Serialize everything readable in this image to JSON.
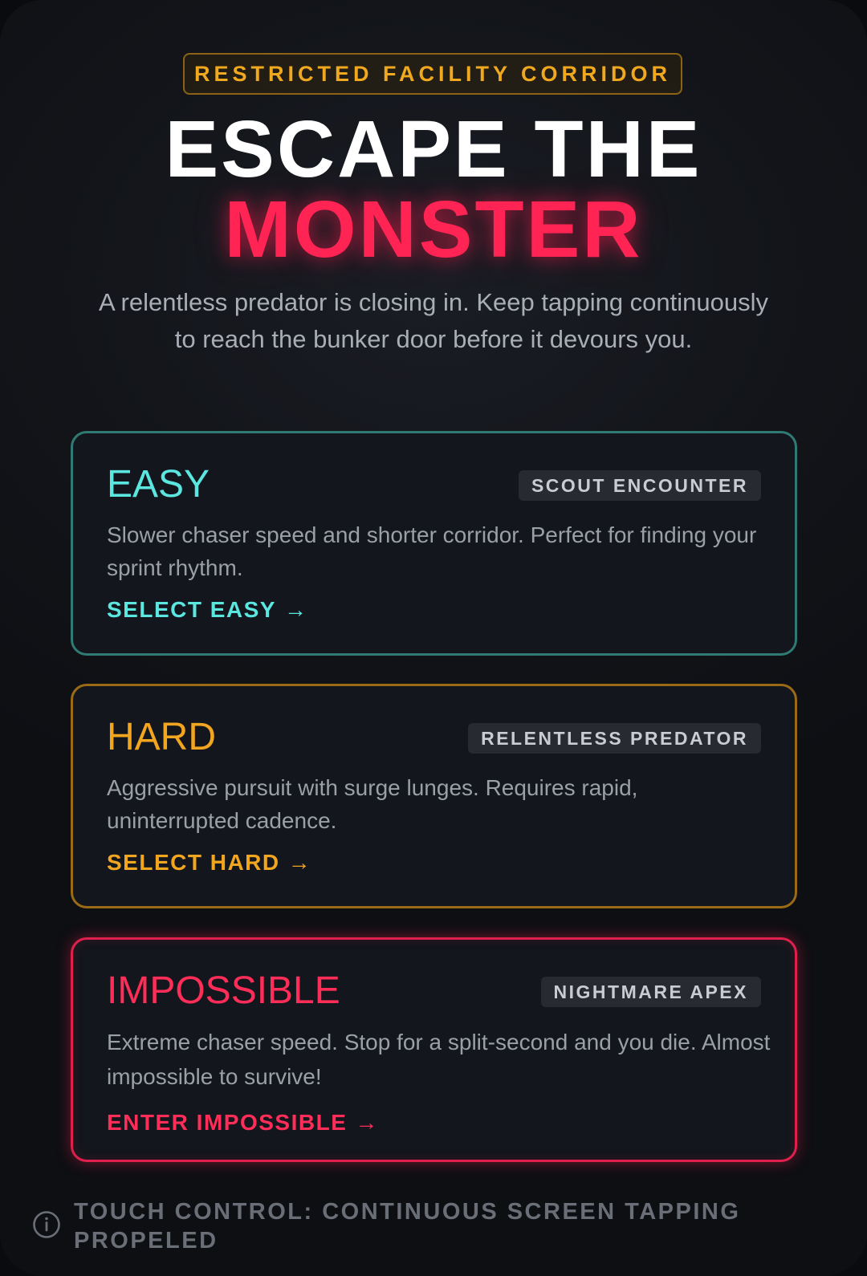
{
  "header": {
    "location_badge": "RESTRICTED FACILITY CORRIDOR",
    "title_line1": "ESCAPE THE",
    "title_line2": "MONSTER",
    "intro": "A relentless predator is closing in. Keep tapping continuously to reach the bunker door before it devours you."
  },
  "difficulties": [
    {
      "title": "EASY",
      "badge": "SCOUT ENCOUNTER",
      "description": "Slower chaser speed and shorter corridor. Perfect for finding your sprint rhythm.",
      "action": "SELECT EASY",
      "color": "#5ce6e0"
    },
    {
      "title": "HARD",
      "badge": "RELENTLESS PREDATOR",
      "description": "Aggressive pursuit with surge lunges. Requires rapid, uninterrupted cadence.",
      "action": "SELECT HARD",
      "color": "#f2a51f"
    },
    {
      "title": "IMPOSSIBLE",
      "badge": "NIGHTMARE APEX",
      "description": "Extreme chaser speed. Stop for a split-second and you die. Almost impossible to survive!",
      "action": "ENTER IMPOSSIBLE",
      "color": "#ff2d58"
    }
  ],
  "arrow_glyph": "→",
  "footer": {
    "icon": "info-icon",
    "text": "TOUCH CONTROL: CONTINUOUS SCREEN TAPPING PROPELED"
  }
}
